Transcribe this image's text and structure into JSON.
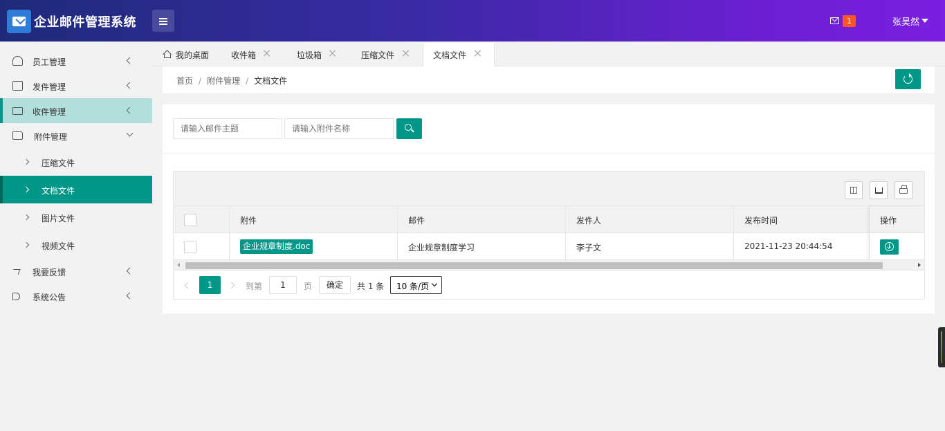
{
  "app": {
    "title": "企业邮件管理系统"
  },
  "header": {
    "mail_count": "1",
    "user_name": "张昊然"
  },
  "sidebar": {
    "items": [
      {
        "label": "员工管理",
        "icon": "user-icon"
      },
      {
        "label": "发件管理",
        "icon": "compose-icon"
      },
      {
        "label": "收件管理",
        "icon": "mail-icon"
      },
      {
        "label": "附件管理",
        "icon": "folder-icon"
      },
      {
        "label": "我要反馈",
        "icon": "share-icon"
      },
      {
        "label": "系统公告",
        "icon": "speaker-icon"
      }
    ],
    "sub_items": [
      {
        "label": "压缩文件"
      },
      {
        "label": "文档文件"
      },
      {
        "label": "图片文件"
      },
      {
        "label": "视频文件"
      }
    ]
  },
  "tabs": [
    {
      "label": "我的桌面"
    },
    {
      "label": "收件箱"
    },
    {
      "label": "垃圾箱"
    },
    {
      "label": "压缩文件"
    },
    {
      "label": "文档文件"
    }
  ],
  "breadcrumb": {
    "home": "首页",
    "parent": "附件管理",
    "current": "文档文件"
  },
  "search": {
    "subject_placeholder": "请输入邮件主题",
    "attachment_placeholder": "请输入附件名称"
  },
  "table": {
    "headers": {
      "attachment": "附件",
      "mail": "邮件",
      "sender": "发件人",
      "time": "发布时间",
      "action": "操作"
    },
    "rows": [
      {
        "attachment": "企业规章制度.doc",
        "mail": "企业规章制度学习",
        "sender": "李子文",
        "time": "2021-11-23 20:44:54"
      }
    ]
  },
  "pager": {
    "current": "1",
    "goto_label": "到第",
    "page_input": "1",
    "page_unit": "页",
    "confirm": "确定",
    "total": "共 1 条",
    "page_size": "10 条/页"
  },
  "colors": {
    "accent": "#009688",
    "header_start": "#1f2b7a",
    "header_end": "#7b1fe0",
    "badge": "#ff5722"
  }
}
